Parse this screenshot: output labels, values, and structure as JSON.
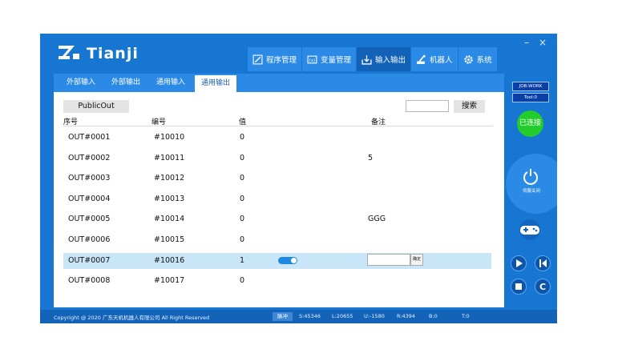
{
  "brand": {
    "name": "Tianji"
  },
  "window": {
    "minimize": "–",
    "close": "×"
  },
  "topnav": [
    {
      "label": "程序管理",
      "icon": "edit-icon"
    },
    {
      "label": "变量管理",
      "icon": "variable-icon"
    },
    {
      "label": "输入输出",
      "icon": "io-icon",
      "active": true
    },
    {
      "label": "机器人",
      "icon": "robot-icon"
    },
    {
      "label": "系统",
      "icon": "gear-icon"
    }
  ],
  "subtabs": [
    {
      "label": "外部输入"
    },
    {
      "label": "外部输出"
    },
    {
      "label": "通用输入"
    },
    {
      "label": "通用输出",
      "active": true
    }
  ],
  "toolbar": {
    "title": "PublicOut",
    "search_value": "",
    "search_label": "搜索"
  },
  "table": {
    "headers": [
      "序号",
      "编号",
      "值",
      "备注"
    ],
    "rows": [
      {
        "seq": "OUT#0001",
        "id": "#10010",
        "value": "0",
        "note": ""
      },
      {
        "seq": "OUT#0002",
        "id": "#10011",
        "value": "0",
        "note": "5"
      },
      {
        "seq": "OUT#0003",
        "id": "#10012",
        "value": "0",
        "note": ""
      },
      {
        "seq": "OUT#0004",
        "id": "#10013",
        "value": "0",
        "note": ""
      },
      {
        "seq": "OUT#0005",
        "id": "#10014",
        "value": "0",
        "note": "GGG"
      },
      {
        "seq": "OUT#0006",
        "id": "#10015",
        "value": "0",
        "note": ""
      },
      {
        "seq": "OUT#0007",
        "id": "#10016",
        "value": "1",
        "note": "",
        "selected": true,
        "toggle_on": true,
        "confirm_label": "确定"
      },
      {
        "seq": "OUT#0008",
        "id": "#10017",
        "value": "0",
        "note": ""
      }
    ]
  },
  "status": {
    "copyright": "Copyright @ 2020 广东天机机器人有限公司 All Right Reserved",
    "mode": "脉冲",
    "s": "S:45346",
    "l": "L:20655",
    "u": "U:-1580",
    "r": "R:4394",
    "b": "B:0",
    "t": "T:0"
  },
  "side": {
    "job": "JOB:WORK",
    "tool": "Tool:0",
    "connected": "已连接",
    "power_label": "伺服关闭"
  },
  "colors": {
    "primary": "#1776d2",
    "tab": "#2a8ae6",
    "active_tab": "#1262b8",
    "connected": "#22cc2a",
    "selected_row": "#c9e6f8"
  }
}
